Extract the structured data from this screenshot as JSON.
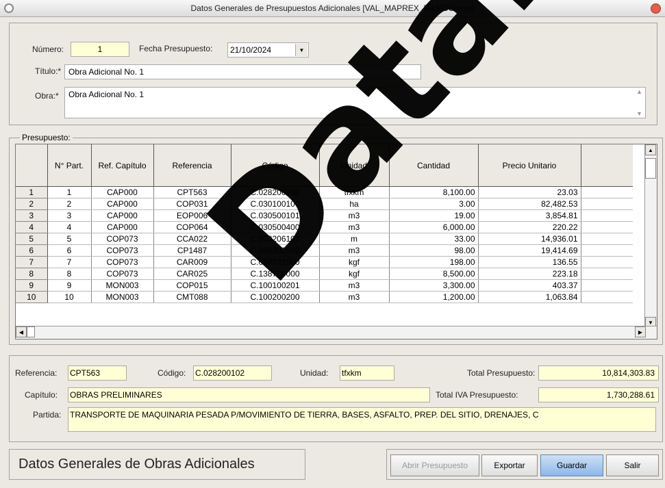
{
  "window": {
    "title": "Datos Generales de Presupuestos Adicionales [VAL_MAPREX_BASICO.vmx]"
  },
  "header": {
    "numero_label": "Número:",
    "numero_value": "1",
    "fecha_label": "Fecha Presupuesto:",
    "fecha_value": "21/10/2024",
    "titulo_label": "Título:*",
    "titulo_value": "Obra Adicional No. 1",
    "obra_label": "Obra:*",
    "obra_value": "Obra Adicional No. 1"
  },
  "grid": {
    "group_label": "Presupuesto:",
    "columns": [
      "N° Part.",
      "Ref. Capítulo",
      "Referencia",
      "Código",
      "Unidad",
      "Cantidad",
      "Precio Unitario"
    ],
    "rows": [
      [
        "1",
        "1",
        "CAP000",
        "CPT563",
        "C.028200102",
        "tfxkm",
        "8,100.00",
        "23.03"
      ],
      [
        "2",
        "2",
        "CAP000",
        "COP031",
        "C.030100100",
        "ha",
        "3.00",
        "82,482.53"
      ],
      [
        "3",
        "3",
        "CAP000",
        "EOP006",
        "C.030500101",
        "m3",
        "19.00",
        "3,854.81"
      ],
      [
        "4",
        "4",
        "CAP000",
        "COP064",
        "C.030500400",
        "m3",
        "6,000.00",
        "220.22"
      ],
      [
        "5",
        "5",
        "COP073",
        "CCA022",
        "C.050206102",
        "m",
        "33.00",
        "14,936.01"
      ],
      [
        "6",
        "6",
        "COP073",
        "CP1487",
        "C.058302503",
        "m3",
        "98.00",
        "19,414.69"
      ],
      [
        "7",
        "7",
        "COP073",
        "CAR009",
        "C.058721000",
        "kgf",
        "198.00",
        "136.55"
      ],
      [
        "8",
        "8",
        "COP073",
        "CAR025",
        "C.138750000",
        "kgf",
        "8,500.00",
        "223.18"
      ],
      [
        "9",
        "9",
        "MON003",
        "COP015",
        "C.100100201",
        "m3",
        "3,300.00",
        "403.37"
      ],
      [
        "10",
        "10",
        "MON003",
        "CMT088",
        "C.100200200",
        "m3",
        "1,200.00",
        "1,063.84"
      ]
    ]
  },
  "details": {
    "referencia_label": "Referencia:",
    "referencia_value": "CPT563",
    "codigo_label": "Código:",
    "codigo_value": "C.028200102",
    "unidad_label": "Unidad:",
    "unidad_value": "tfxkm",
    "total_label": "Total Presupuesto:",
    "total_value": "10,814,303.83",
    "capitulo_label": "Capítulo:",
    "capitulo_value": "OBRAS PRELIMINARES",
    "iva_label": "Total IVA Presupuesto:",
    "iva_value": "1,730,288.61",
    "partida_label": "Partida:",
    "partida_value": "TRANSPORTE DE MAQUINARIA PESADA P/MOVIMIENTO DE TIERRA, BASES, ASFALTO, PREP. DEL SITIO, DRENAJES, C"
  },
  "footer": {
    "title": "Datos Generales de Obras Adicionales",
    "abrir": "Abrir Presupuesto",
    "exportar": "Exportar",
    "guardar": "Guardar",
    "salir": "Salir"
  },
  "watermark": "DataLair"
}
